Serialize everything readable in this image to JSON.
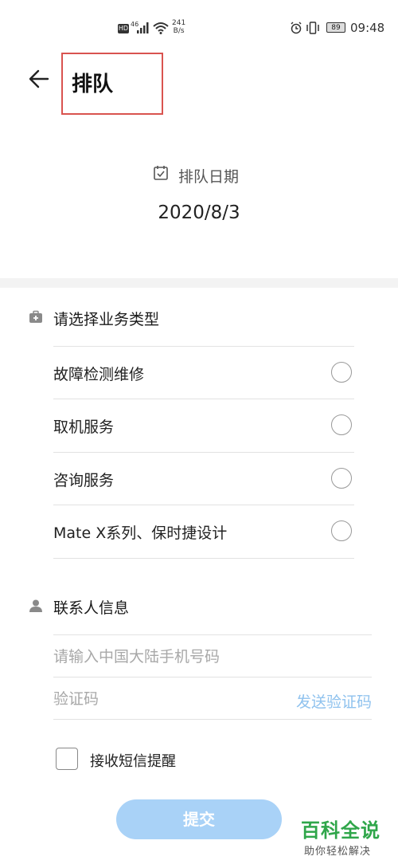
{
  "status_bar": {
    "hd": "HD",
    "network": "46",
    "speed_value": "241",
    "speed_unit": "B/s",
    "battery": "89",
    "time": "09:48"
  },
  "header": {
    "title": "排队"
  },
  "date": {
    "label": "排队日期",
    "value": "2020/8/3"
  },
  "service_type": {
    "title": "请选择业务类型",
    "options": [
      {
        "label": "故障检测维修",
        "selected": false
      },
      {
        "label": "取机服务",
        "selected": false
      },
      {
        "label": "咨询服务",
        "selected": false
      },
      {
        "label": "Mate X系列、保时捷设计",
        "selected": false
      }
    ]
  },
  "contact": {
    "title": "联系人信息",
    "phone_placeholder": "请输入中国大陆手机号码",
    "code_placeholder": "验证码",
    "send_code_label": "发送验证码"
  },
  "sms_reminder": {
    "label": "接收短信提醒",
    "checked": false
  },
  "submit_label": "提交",
  "watermark": {
    "title": "百科全说",
    "subtitle": "助你轻松解决"
  },
  "colors": {
    "accent_light": "#a9d2f7",
    "link": "#8fc2ee",
    "highlight_border": "#d9534f",
    "watermark_green": "#2fa64a"
  }
}
